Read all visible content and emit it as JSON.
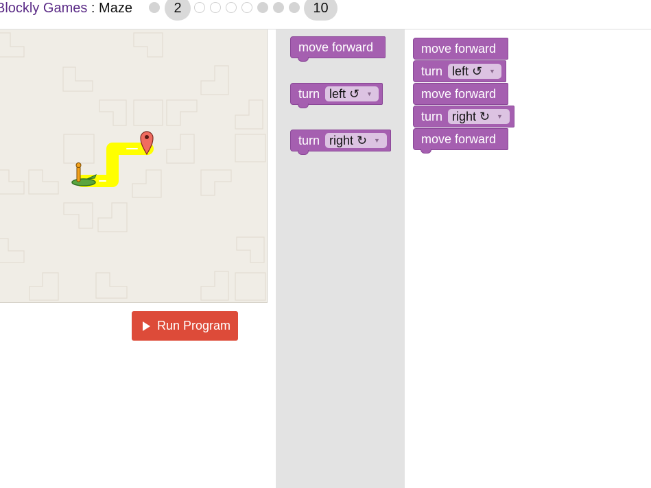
{
  "header": {
    "title_link": "Blockly Games",
    "title_sep": " : ",
    "title_name": "Maze",
    "levels": {
      "current": "2",
      "last": "10"
    }
  },
  "run_button": {
    "label": "Run Program"
  },
  "toolbox": {
    "move_forward": "move forward",
    "turn_left_label": "turn",
    "turn_left_value": "left ↺",
    "turn_right_label": "turn",
    "turn_right_value": "right ↻"
  },
  "workspace": {
    "block1": "move forward",
    "block2_label": "turn",
    "block2_value": "left ↺",
    "block3": "move forward",
    "block4_label": "turn",
    "block4_value": "right ↻",
    "block5": "move forward"
  },
  "colors": {
    "block": "#a55fb0",
    "run_button": "#dd4b39",
    "path": "#ffff00",
    "link": "#5a2a86"
  },
  "icons": [
    "play-icon",
    "pegman-icon",
    "finish-marker-icon",
    "dropdown-arrow-icon"
  ]
}
